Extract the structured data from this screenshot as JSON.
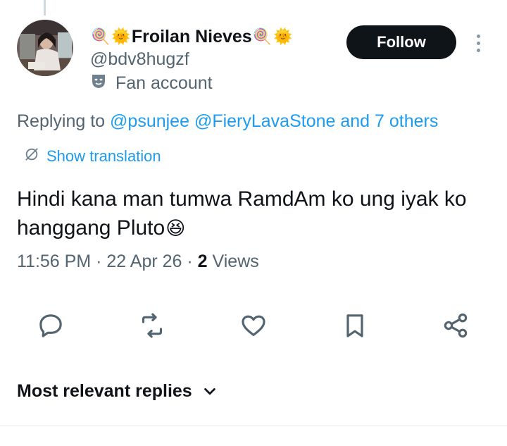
{
  "author": {
    "display_name": "Froilan Nieves",
    "emoji_left_1": "🍭",
    "emoji_left_2": "🌞",
    "emoji_right_1": "🍭",
    "emoji_right_2": "🌞",
    "handle": "@bdv8hugzf",
    "account_label": "Fan account",
    "label_icon": "theater-masks-icon"
  },
  "follow_button": {
    "label": "Follow"
  },
  "reply_context": {
    "prefix": "Replying to",
    "mentions": [
      "@psunjee",
      "@FieryLavaStone"
    ],
    "others": "and 7 others"
  },
  "translation": {
    "label": "Show translation",
    "icon": "translate-icon"
  },
  "tweet": {
    "text": "Hindi kana man tumwa RamdAm ko ung iyak ko hanggang Pluto",
    "emoji": "😆",
    "time": "11:56 PM",
    "separator": "·",
    "date": "22 Apr 26",
    "views_count": "2",
    "views_label": "Views"
  },
  "actions": [
    {
      "name": "reply",
      "icon": "reply-icon"
    },
    {
      "name": "retweet",
      "icon": "retweet-icon"
    },
    {
      "name": "like",
      "icon": "heart-icon"
    },
    {
      "name": "bookmark",
      "icon": "bookmark-icon"
    },
    {
      "name": "share",
      "icon": "share-icon"
    }
  ],
  "replies_header": {
    "label": "Most relevant replies"
  },
  "colors": {
    "accent": "#1d9bf0",
    "text": "#0f1419",
    "secondary": "#536471",
    "button_bg": "#0f1419",
    "icon": "#536471"
  }
}
